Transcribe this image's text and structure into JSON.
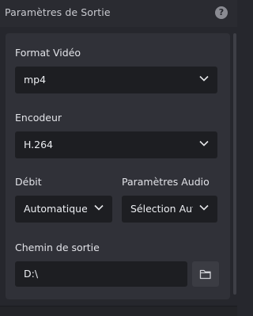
{
  "header": {
    "title": "Paramètres de Sortie",
    "help": "?"
  },
  "output": {
    "video_format": {
      "label": "Format Vidéo",
      "value": "mp4"
    },
    "encoder": {
      "label": "Encodeur",
      "value": "H.264"
    },
    "bitrate": {
      "label": "Débit",
      "value": "Automatique"
    },
    "audio": {
      "label": "Paramètres Audio",
      "value": "Sélection Auto"
    },
    "path": {
      "label": "Chemin de sortie",
      "value": "D:\\"
    }
  }
}
